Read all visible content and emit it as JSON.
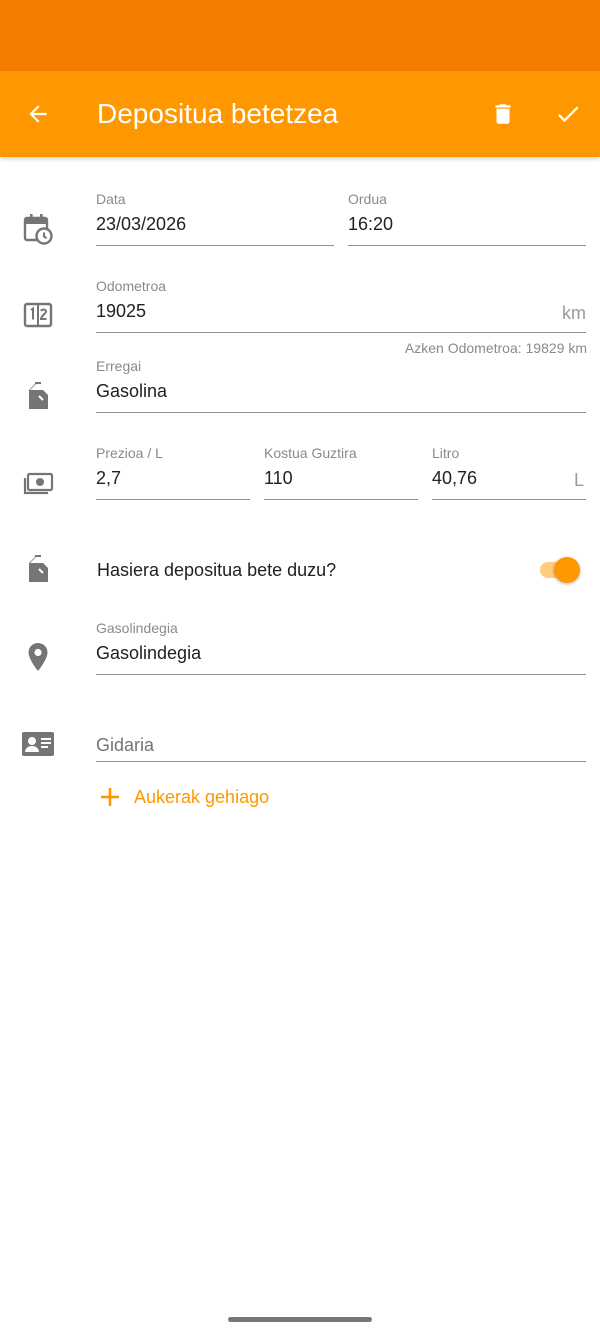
{
  "app_bar": {
    "title": "Depositua betetzea",
    "color": "#FF9800",
    "status_color": "#F57C00",
    "back_icon": "arrow-back-icon",
    "delete_icon": "trash-icon",
    "save_icon": "check-icon"
  },
  "date_time": {
    "date_label": "Data",
    "date_value": "23/03/2026",
    "time_label": "Ordua",
    "time_value": "16:20"
  },
  "odometer": {
    "label": "Odometroa",
    "value": "19025",
    "unit": "km",
    "helper": "Azken Odometroa: 19829 km"
  },
  "fuel": {
    "label": "Erregai",
    "value": "Gasolina"
  },
  "cost": {
    "price_label": "Prezioa / L",
    "price_value": "2,7",
    "total_label": "Kostua Guztira",
    "total_value": "110",
    "liters_label": "Litro",
    "liters_value": "40,76",
    "liters_unit": "L"
  },
  "full_tank": {
    "label": "Hasiera depositua bete duzu?",
    "on": true
  },
  "station": {
    "label": "Gasolindegia",
    "value": "Gasolindegia"
  },
  "driver": {
    "placeholder": "Gidaria"
  },
  "more_options": {
    "label": "Aukerak gehiago"
  }
}
